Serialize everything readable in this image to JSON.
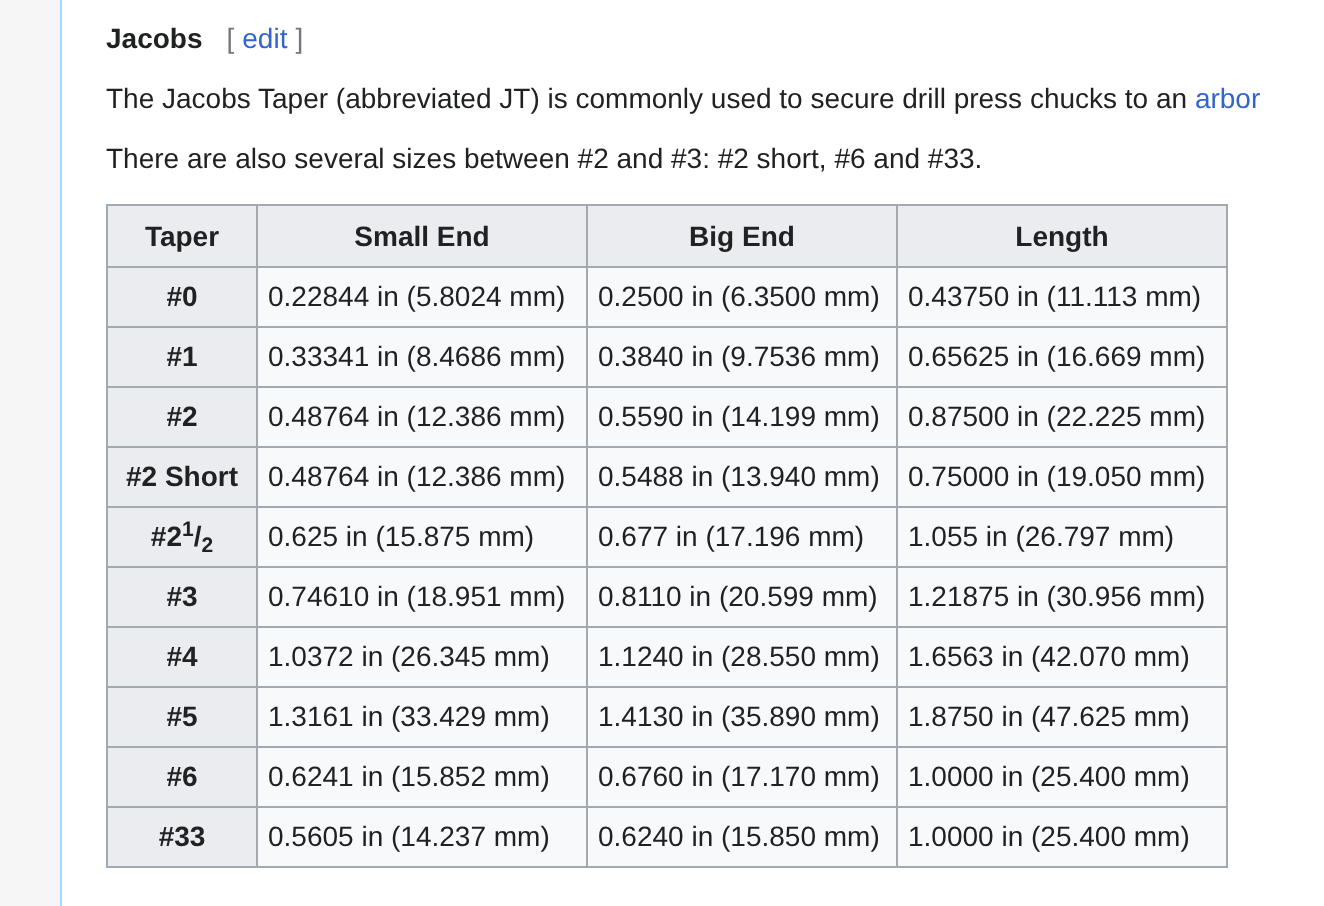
{
  "section": {
    "heading": "Jacobs",
    "edit_open": "[",
    "edit_link": "edit",
    "edit_close": "]"
  },
  "paragraphs": [
    {
      "text": "The Jacobs Taper (abbreviated JT) is commonly used to secure drill press chucks to an",
      "link": "arbor"
    },
    {
      "text": "There are also several sizes between #2 and #3: #2 short, #6 and #33."
    }
  ],
  "table": {
    "columns": [
      "Taper",
      "Small End",
      "Big End",
      "Length"
    ],
    "rows": [
      [
        "#0",
        "0.22844 in (5.8024 mm)",
        "0.2500 in (6.3500 mm)",
        "0.43750 in (11.113 mm)"
      ],
      [
        "#1",
        "0.33341 in (8.4686 mm)",
        "0.3840 in (9.7536 mm)",
        "0.65625 in (16.669 mm)"
      ],
      [
        "#2",
        "0.48764 in (12.386 mm)",
        "0.5590 in (14.199 mm)",
        "0.87500 in (22.225 mm)"
      ],
      [
        "#2 Short",
        "0.48764 in (12.386 mm)",
        "0.5488 in (13.940 mm)",
        "0.75000 in (19.050 mm)"
      ],
      [
        "#2$^{1}$/$_{2}$",
        "0.625 in (15.875 mm)",
        "0.677 in (17.196 mm)",
        "1.055 in (26.797 mm)"
      ],
      [
        "#3",
        "0.74610 in (18.951 mm)",
        "0.8110 in (20.599 mm)",
        "1.21875 in (30.956 mm)"
      ],
      [
        "#4",
        "1.0372 in (26.345 mm)",
        "1.1240 in (28.550 mm)",
        "1.6563 in (42.070 mm)"
      ],
      [
        "#5",
        "1.3161 in (33.429 mm)",
        "1.4130 in (35.890 mm)",
        "1.8750 in (47.625 mm)"
      ],
      [
        "#6",
        "0.6241 in (15.852 mm)",
        "0.6760 in (17.170 mm)",
        "1.0000 in (25.400 mm)"
      ],
      [
        "#33",
        "0.5605 in (14.237 mm)",
        "0.6240 in (15.850 mm)",
        "1.0000 in (25.400 mm)"
      ]
    ]
  }
}
